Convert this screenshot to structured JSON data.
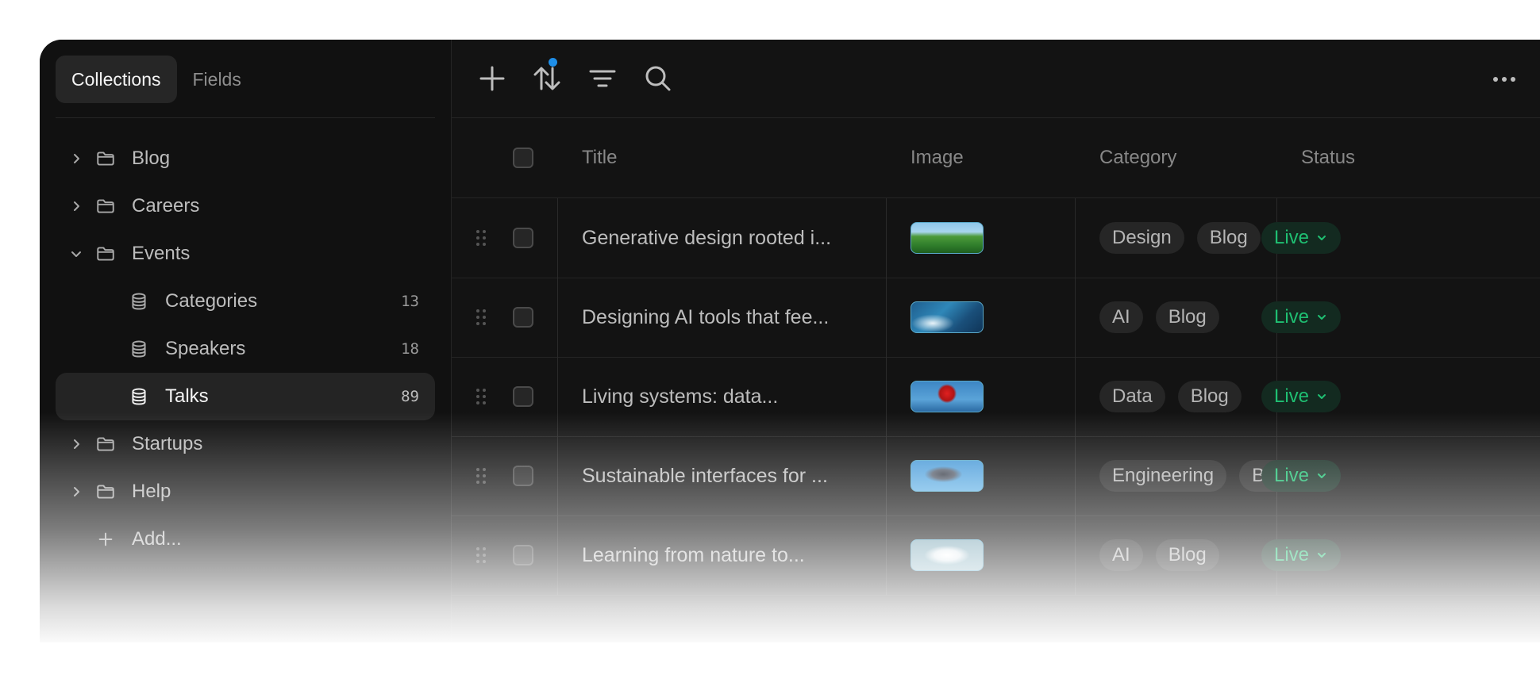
{
  "sidebar": {
    "tabs": [
      "Collections",
      "Fields"
    ],
    "items": [
      {
        "label": "Blog"
      },
      {
        "label": "Careers"
      },
      {
        "label": "Events"
      },
      {
        "label": "Categories",
        "count": "13"
      },
      {
        "label": "Speakers",
        "count": "18"
      },
      {
        "label": "Talks",
        "count": "89"
      },
      {
        "label": "Startups"
      },
      {
        "label": "Help"
      },
      {
        "label": "Add..."
      }
    ]
  },
  "toolbar": {
    "icons": [
      "plus-icon",
      "sort-icon",
      "filter-icon",
      "search-icon",
      "more-icon"
    ],
    "sort_indicator_color": "#1e8ee8"
  },
  "table": {
    "columns": [
      "Title",
      "Image",
      "Category",
      "Status"
    ],
    "rows": [
      {
        "title": "Generative design rooted i...",
        "tags": [
          "Design",
          "Blog"
        ],
        "status": "Live"
      },
      {
        "title": "Designing AI tools that fee...",
        "tags": [
          "AI",
          "Blog"
        ],
        "status": "Live"
      },
      {
        "title": "Living systems: data...",
        "tags": [
          "Data",
          "Blog"
        ],
        "status": "Live"
      },
      {
        "title": "Sustainable interfaces for ...",
        "tags": [
          "Engineering",
          "Blog"
        ],
        "status": "Live"
      },
      {
        "title": "Learning from nature to...",
        "tags": [
          "AI",
          "Blog"
        ],
        "status": "Live"
      }
    ]
  },
  "colors": {
    "window_bg": "#131313",
    "status_live": "#1fbf72",
    "status_live_bg": "#132a20"
  }
}
